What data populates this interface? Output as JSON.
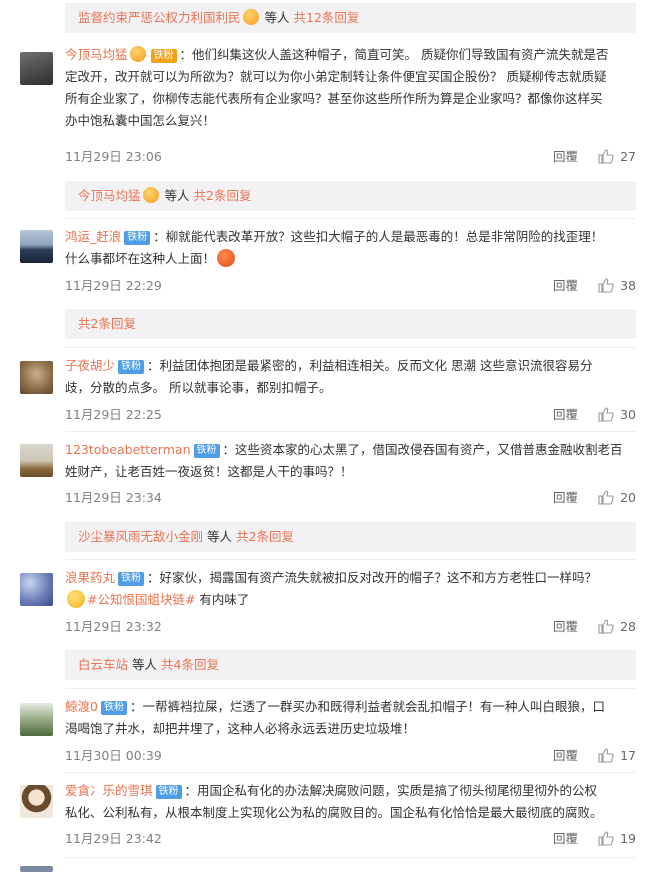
{
  "subreplies": [
    {
      "user": "监督约束严惩公权力利国利民",
      "middle": "等人",
      "count": "共12条回复"
    },
    {
      "user": "今顶马均猛",
      "middle": "等人",
      "count": "共2条回复"
    },
    {
      "user": "",
      "middle": "",
      "count": "共2条回复"
    },
    {
      "user": "沙尘暴风雨无敌小金刚",
      "middle": "等人",
      "count": "共2条回复"
    },
    {
      "user": "白云车站",
      "middle": "等人",
      "count": "共4条回复"
    }
  ],
  "comments": [
    {
      "user": "今顶马均猛",
      "badge": "铁粉",
      "lines": [
        "：他们纠集这伙人盖这种帽子，简直可笑。 质疑你们导致国有资产流失就是否",
        "定改开，改开就可以为所欲为？就可以为你小弟定制转让条件便宜买国企股份？ 质疑柳传志就质疑",
        "所有企业家了，你柳传志能代表所有企业家吗？甚至你这些所作所为算是企业家吗？都像你这样买",
        "办中饱私囊中国怎么复兴！"
      ],
      "time": "11月29日 23:06",
      "reply": "回覆",
      "likes": "27"
    },
    {
      "user": "鸿运_赶浪",
      "badge": "铁粉",
      "lines": [
        "：柳就能代表改革开放？这些扣大帽子的人是最恶毒的！总是非常阴险的找歪理！",
        "什么事都坏在这种人上面！"
      ],
      "time": "11月29日 22:29",
      "reply": "回覆",
      "likes": "38"
    },
    {
      "user": "子夜胡少",
      "badge": "铁粉",
      "lines": [
        "：利益团体抱团是最紧密的，利益相连相关。反而文化 思潮 这些意识流很容易分",
        "歧，分散的点多。 所以就事论事，都别扣帽子。"
      ],
      "time": "11月29日 22:25",
      "reply": "回覆",
      "likes": "30"
    },
    {
      "user": "123tobeabetterman",
      "badge": "铁粉",
      "lines": [
        "：这些资本家的心太黑了，借国改侵吞国有资产，又借普惠金融收割老百",
        "姓财产，让老百姓一夜返贫！这都是人干的事吗？！"
      ],
      "time": "11月29日 23:34",
      "reply": "回覆",
      "likes": "20"
    },
    {
      "user": "浪果药丸",
      "badge": "铁粉",
      "lines": [
        "：好家伙，揭露国有资产流失就被扣反对改开的帽子？这不和方方老牲口一样吗？"
      ],
      "tag": "#公知恨国蛆块链#",
      "tail": " 有内味了",
      "time": "11月29日 23:32",
      "reply": "回覆",
      "likes": "28"
    },
    {
      "user": "鯨渡0",
      "badge": "铁粉",
      "lines": [
        "：一帮裤裆拉屎，烂透了一群买办和既得利益者就会乱扣帽子！有一种人叫白眼狼，口",
        "渴喝饱了井水，却把井埋了，这种人必将永远丢进历史垃圾堆！"
      ],
      "time": "11月30日 00:39",
      "reply": "回覆",
      "likes": "17"
    },
    {
      "user": "爱貪冫乐的雪琪",
      "badge": "铁粉",
      "lines": [
        "：用国企私有化的办法解决腐败问题，实质是搞了彻头彻尾彻里彻外的公权",
        "私化、公利私有，从根本制度上实现化公为私的腐败目的。国企私有化恰恰是最大最彻底的腐败。"
      ],
      "time": "11月29日 23:42",
      "reply": "回覆",
      "likes": "19"
    }
  ],
  "colors": {
    "accent": "#eb7350",
    "badge": "#4f9ee5",
    "subbar": "#f2f2f5",
    "meta": "#808080"
  }
}
